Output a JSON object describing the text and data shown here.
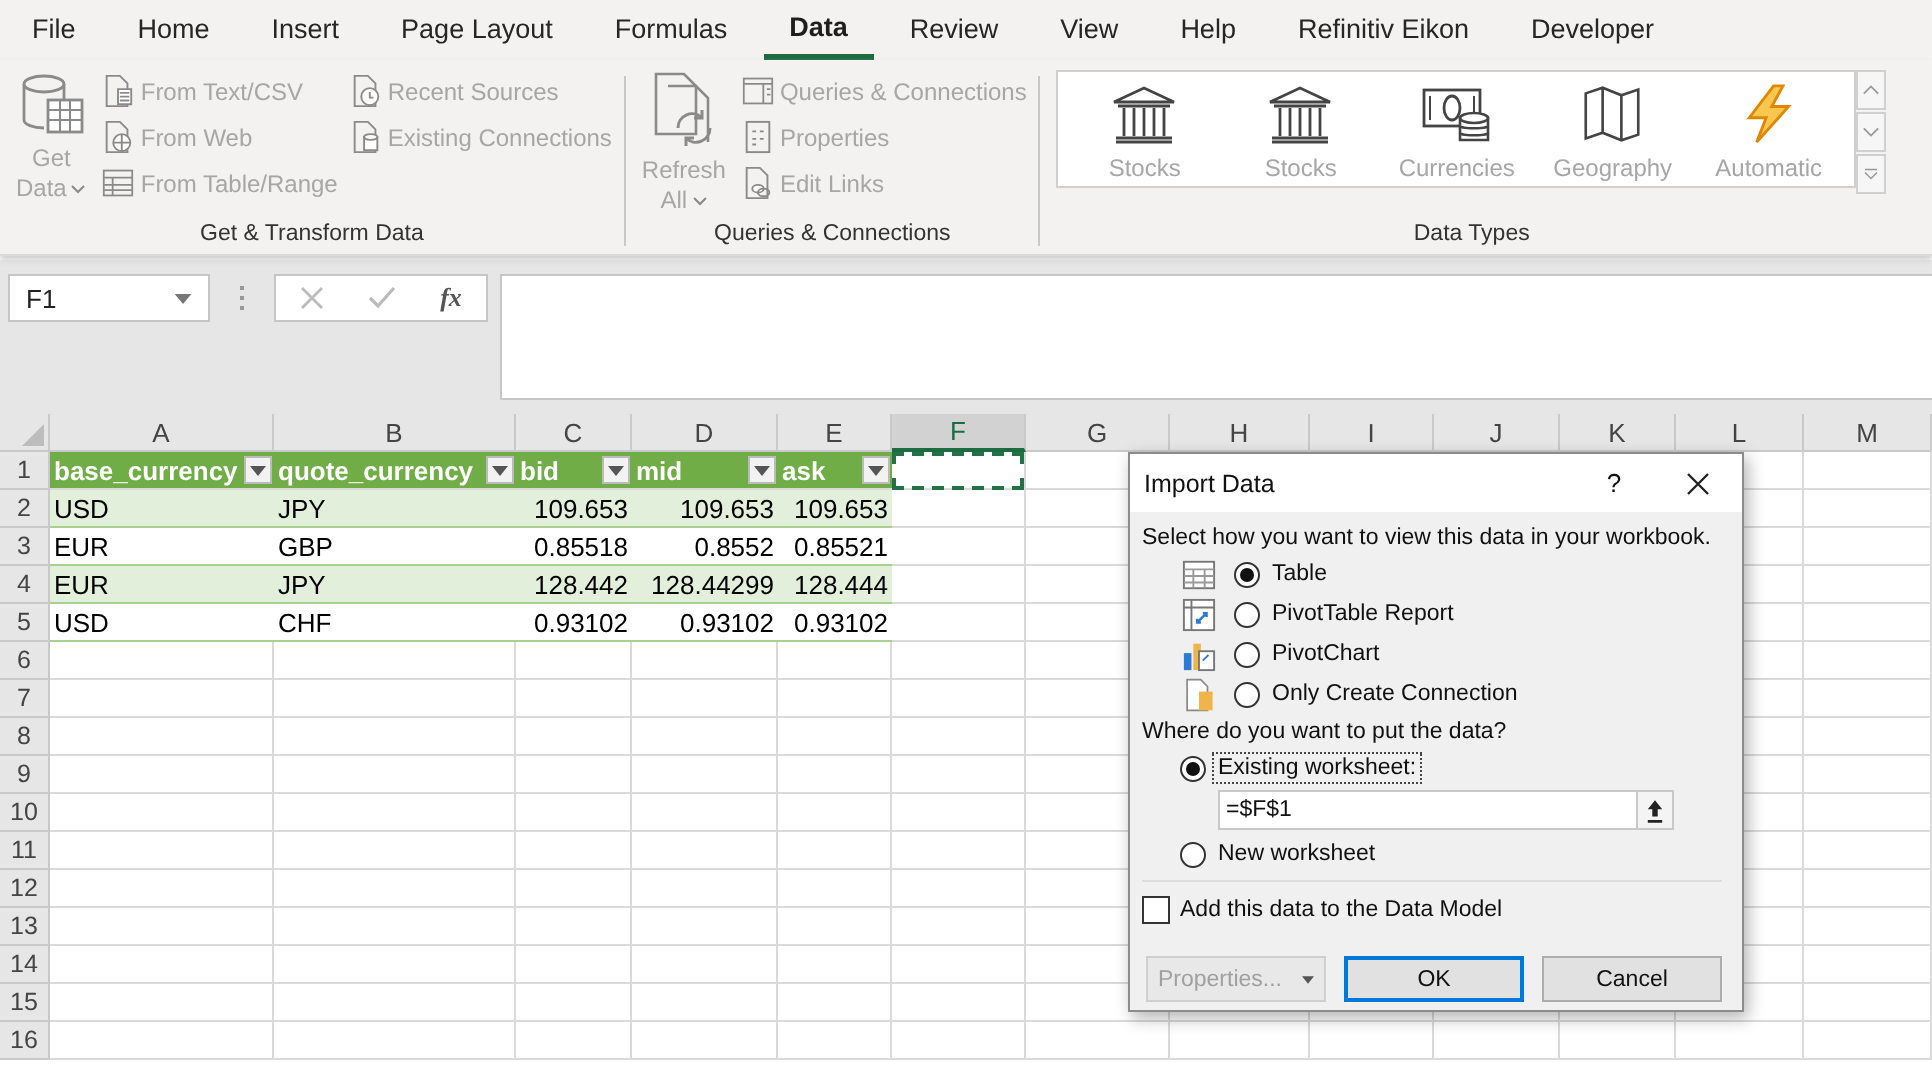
{
  "menu_tabs": [
    {
      "label": "File",
      "selected": false
    },
    {
      "label": "Home",
      "selected": false
    },
    {
      "label": "Insert",
      "selected": false
    },
    {
      "label": "Page Layout",
      "selected": false
    },
    {
      "label": "Formulas",
      "selected": false
    },
    {
      "label": "Data",
      "selected": true
    },
    {
      "label": "Review",
      "selected": false
    },
    {
      "label": "View",
      "selected": false
    },
    {
      "label": "Help",
      "selected": false
    },
    {
      "label": "Refinitiv Eikon",
      "selected": false
    },
    {
      "label": "Developer",
      "selected": false
    }
  ],
  "ribbon_groups": [
    {
      "label": "Get & Transform Data",
      "large_button": {
        "lines": [
          "Get",
          "Data"
        ],
        "dropdown": true,
        "disabled": true
      },
      "columns": [
        [
          {
            "label": "From Text/CSV",
            "disabled": true
          },
          {
            "label": "From Web",
            "disabled": true
          },
          {
            "label": "From Table/Range",
            "disabled": true
          }
        ],
        [
          {
            "label": "Recent Sources",
            "disabled": true
          },
          {
            "label": "Existing Connections",
            "disabled": true
          }
        ]
      ]
    },
    {
      "label": "Queries & Connections",
      "large_button": {
        "lines": [
          "Refresh",
          "All"
        ],
        "dropdown": true,
        "disabled": true
      },
      "columns": [
        [
          {
            "label": "Queries & Connections",
            "disabled": true
          },
          {
            "label": "Properties",
            "disabled": true
          },
          {
            "label": "Edit Links",
            "disabled": true
          }
        ]
      ]
    }
  ],
  "data_types": {
    "label": "Data Types",
    "items": [
      {
        "label": "Stocks",
        "disabled": true
      },
      {
        "label": "Stocks",
        "disabled": true
      },
      {
        "label": "Currencies",
        "disabled": true
      },
      {
        "label": "Geography",
        "disabled": true
      },
      {
        "label": "Automatic",
        "disabled": true
      }
    ]
  },
  "formula_bar": {
    "name_box": "F1",
    "function_label": "fx"
  },
  "sheet": {
    "columns": [
      {
        "label": "A",
        "selected": false
      },
      {
        "label": "B",
        "selected": false
      },
      {
        "label": "C",
        "selected": false
      },
      {
        "label": "D",
        "selected": false
      },
      {
        "label": "E",
        "selected": false
      },
      {
        "label": "F",
        "selected": true
      },
      {
        "label": "G",
        "selected": false
      },
      {
        "label": "H",
        "selected": false
      },
      {
        "label": "I",
        "selected": false
      },
      {
        "label": "J",
        "selected": false
      },
      {
        "label": "K",
        "selected": false
      },
      {
        "label": "L",
        "selected": false
      },
      {
        "label": "M",
        "selected": false
      }
    ],
    "rows": [
      {
        "label": "1",
        "marquee": true
      },
      {
        "label": "2",
        "marquee": false
      },
      {
        "label": "3",
        "marquee": false
      },
      {
        "label": "4",
        "marquee": false
      },
      {
        "label": "5",
        "marquee": false
      },
      {
        "label": "6",
        "marquee": false
      },
      {
        "label": "7",
        "marquee": false
      },
      {
        "label": "8",
        "marquee": false
      },
      {
        "label": "9",
        "marquee": false
      },
      {
        "label": "10",
        "marquee": false
      },
      {
        "label": "11",
        "marquee": false
      },
      {
        "label": "12",
        "marquee": false
      },
      {
        "label": "13",
        "marquee": false
      },
      {
        "label": "14",
        "marquee": false
      },
      {
        "label": "15",
        "marquee": false
      },
      {
        "label": "16",
        "marquee": false
      }
    ]
  },
  "table": {
    "columns": [
      {
        "header": "base_currency"
      },
      {
        "header": "quote_currency"
      },
      {
        "header": "bid"
      },
      {
        "header": "mid"
      },
      {
        "header": "ask"
      }
    ],
    "rows": [
      {
        "cells": [
          "USD",
          "JPY",
          "109.653",
          "109.653",
          "109.653"
        ],
        "banded": true
      },
      {
        "cells": [
          "EUR",
          "GBP",
          "0.85518",
          "0.8552",
          "0.85521"
        ],
        "banded": false
      },
      {
        "cells": [
          "EUR",
          "JPY",
          "128.442",
          "128.44299",
          "128.444"
        ],
        "banded": true
      },
      {
        "cells": [
          "USD",
          "CHF",
          "0.93102",
          "0.93102",
          "0.93102"
        ],
        "banded": false
      }
    ]
  },
  "dialog": {
    "title": "Import Data",
    "help": "?",
    "prompt": "Select how you want to view this data in your workbook.",
    "view_options": [
      {
        "label": "Table",
        "selected": true
      },
      {
        "label": "PivotTable Report",
        "selected": false
      },
      {
        "label": "PivotChart",
        "selected": false
      },
      {
        "label": "Only Create Connection",
        "selected": false
      }
    ],
    "location_prompt": "Where do you want to put the data?",
    "location_options": [
      {
        "label": "Existing worksheet:",
        "selected": true,
        "focused": true
      },
      {
        "label": "New worksheet",
        "selected": false,
        "focused": false
      }
    ],
    "range_field": {
      "value": "=$F$1"
    },
    "data_model": {
      "label": "Add this data to the Data Model",
      "checked": false
    },
    "buttons": [
      {
        "label": "Properties...",
        "disabled": true,
        "dropdown": true,
        "default": false
      },
      {
        "label": "OK",
        "disabled": false,
        "dropdown": false,
        "default": true
      },
      {
        "label": "Cancel",
        "disabled": false,
        "dropdown": false,
        "default": false
      }
    ]
  }
}
